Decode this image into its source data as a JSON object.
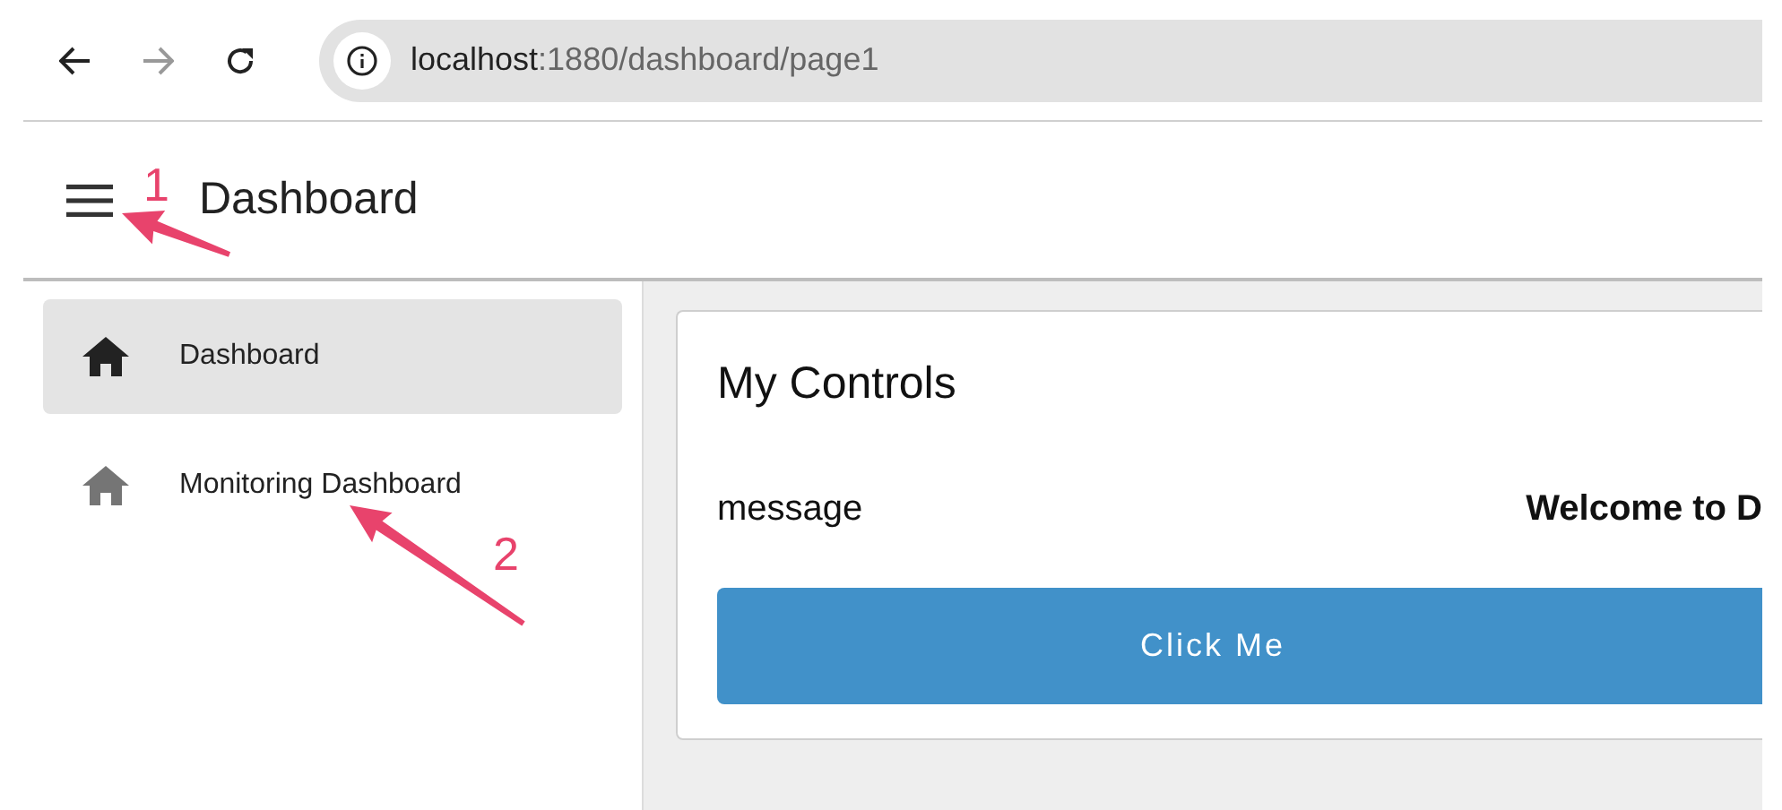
{
  "browser": {
    "url_host": "localhost",
    "url_path": ":1880/dashboard/page1"
  },
  "header": {
    "title": "Dashboard"
  },
  "sidebar": {
    "items": [
      {
        "label": "Dashboard",
        "selected": true
      },
      {
        "label": "Monitoring Dashboard",
        "selected": false
      }
    ]
  },
  "card": {
    "title": "My Controls",
    "rows": [
      {
        "label": "message",
        "value": "Welcome to D"
      }
    ],
    "button": "Click Me"
  },
  "annotations": [
    {
      "number": "1"
    },
    {
      "number": "2"
    }
  ]
}
